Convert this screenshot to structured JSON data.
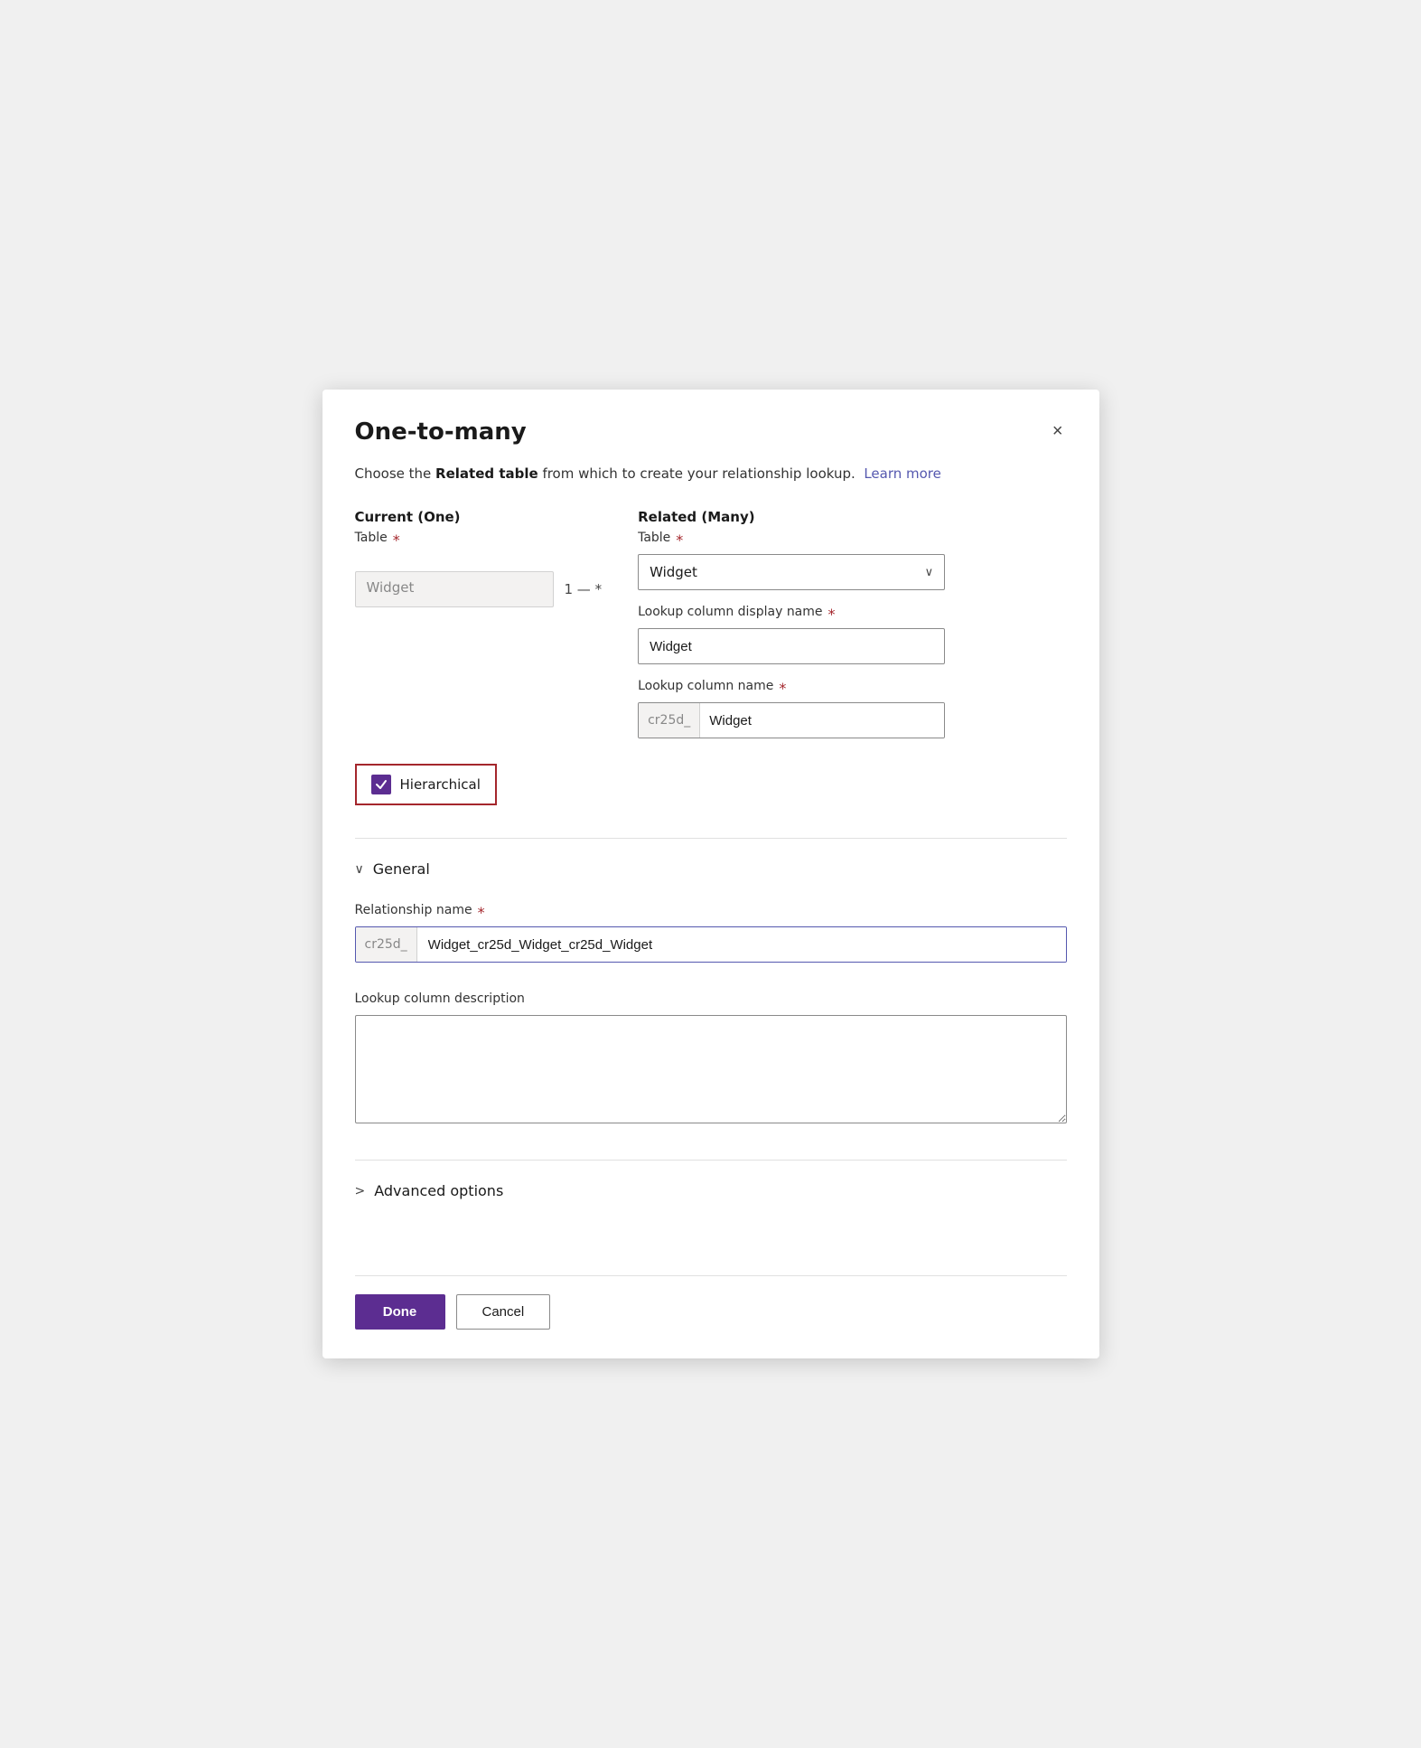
{
  "dialog": {
    "title": "One-to-many",
    "close_label": "×"
  },
  "description": {
    "text_before": "Choose the ",
    "bold_text": "Related table",
    "text_after": " from which to create your relationship lookup.",
    "link_text": "Learn more",
    "link_href": "#"
  },
  "current_section": {
    "heading": "Current (One)",
    "table_label": "Table",
    "required": "*",
    "table_value": "Widget"
  },
  "relation_symbol": {
    "text": "1 — *"
  },
  "related_section": {
    "heading": "Related (Many)",
    "table": {
      "label": "Table",
      "required": "*",
      "value": "Widget",
      "chevron": "∨"
    },
    "lookup_display_name": {
      "label": "Lookup column display name",
      "required": "*",
      "value": "Widget"
    },
    "lookup_column_name": {
      "label": "Lookup column name",
      "required": "*",
      "prefix": "cr25d_",
      "value": "Widget"
    }
  },
  "hierarchical": {
    "label": "Hierarchical",
    "checked": true
  },
  "general_section": {
    "heading": "General",
    "collapsed": false,
    "chevron": "∨",
    "relationship_name": {
      "label": "Relationship name",
      "required": "*",
      "prefix": "cr25d_",
      "value": "Widget_cr25d_Widget_cr25d_Widget"
    },
    "lookup_description": {
      "label": "Lookup column description",
      "value": ""
    }
  },
  "advanced_section": {
    "heading": "Advanced options",
    "collapsed": true,
    "chevron": ">"
  },
  "footer": {
    "done_label": "Done",
    "cancel_label": "Cancel"
  }
}
